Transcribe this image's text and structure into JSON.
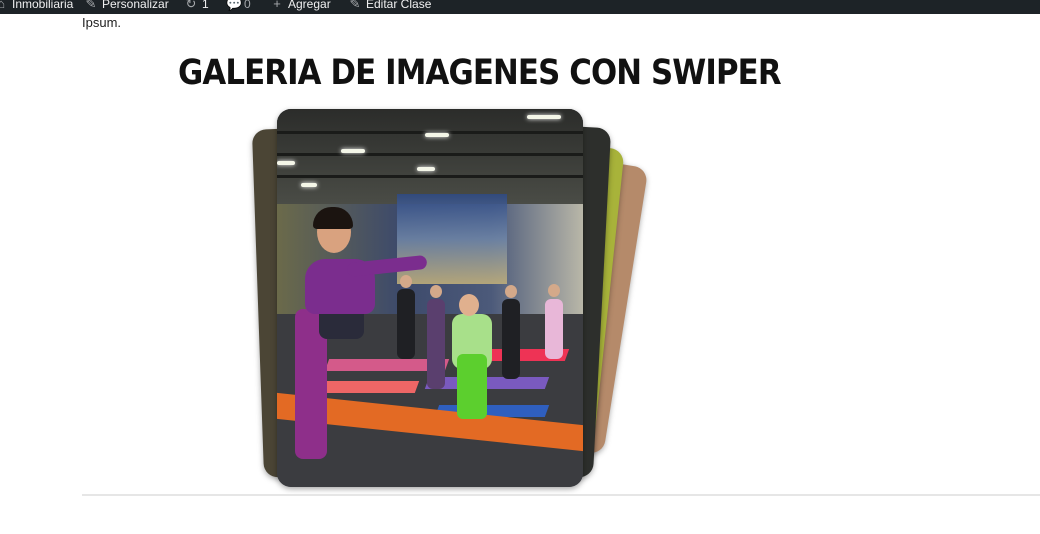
{
  "admin_bar": {
    "items": [
      {
        "icon": "home-icon",
        "label": "Inmobiliaria"
      },
      {
        "icon": "brush-icon",
        "label": "Personalizar"
      },
      {
        "icon": "refresh-icon",
        "label": "1"
      },
      {
        "icon": "comment-icon",
        "label": "0"
      },
      {
        "icon": "plus-icon",
        "label": "Agregar"
      },
      {
        "icon": "pencil-icon",
        "label": "Editar Clase"
      }
    ],
    "background": "#1d2327"
  },
  "content": {
    "excerpt_tail": "Ipsum.",
    "title": "Galeria de imagenes con Swiper"
  },
  "gallery": {
    "effect": "cards",
    "active_slide_alt": "yoga-class-photo"
  }
}
